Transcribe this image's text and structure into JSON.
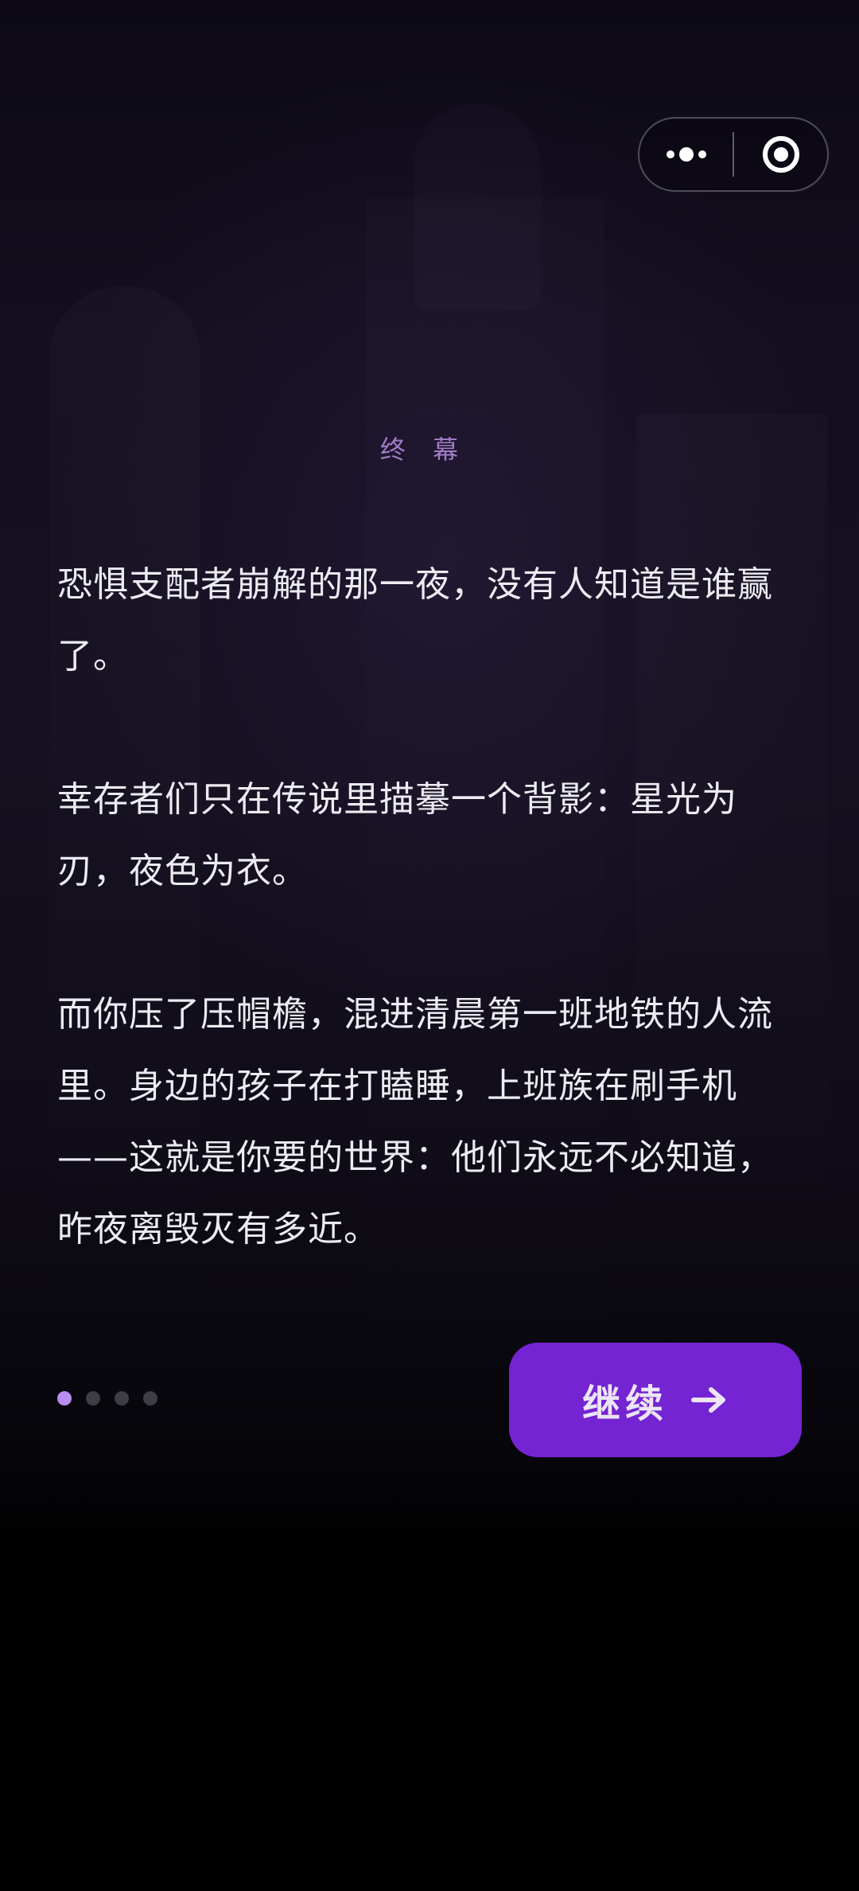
{
  "header": {
    "more_icon": "more-dots-icon",
    "close_icon": "target-close-icon"
  },
  "chapter": {
    "label": "终 幕"
  },
  "story": {
    "paragraphs": [
      "恐惧支配者崩解的那一夜，没有人知道是谁赢了。",
      "幸存者们只在传说里描摹一个背影：星光为刃，夜色为衣。",
      "而你压了压帽檐，混进清晨第一班地铁的人流里。身边的孩子在打瞌睡，上班族在刷手机——这就是你要的世界：他们永远不必知道，昨夜离毁灭有多近。"
    ]
  },
  "pager": {
    "total": 4,
    "current": 1
  },
  "actions": {
    "continue_label": "继续",
    "continue_icon": "arrow-right-icon"
  },
  "colors": {
    "accent": "#7424d2",
    "active_dot": "#b88cf0",
    "chapter_label": "#a07cc4"
  }
}
